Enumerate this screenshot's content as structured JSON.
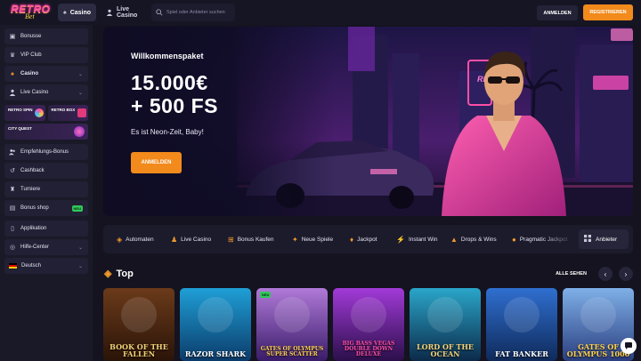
{
  "header": {
    "logo_text": "RETRO",
    "logo_sub": "Bet",
    "tabs": [
      {
        "label": "Casino",
        "icon": "spade-icon"
      },
      {
        "label": "Live Casino",
        "icon": "dealer-icon"
      }
    ],
    "search_placeholder": "Spiel oder Anbieter suchen",
    "login_label": "ANMELDEN",
    "register_label": "REGISTRIEREN"
  },
  "sidebar": {
    "items_top": [
      {
        "label": "Bonusse",
        "icon": "gift-icon"
      },
      {
        "label": "VIP Club",
        "icon": "crown-icon"
      },
      {
        "label": "Casino",
        "icon": "spade-icon"
      },
      {
        "label": "Live Casino",
        "icon": "dealer-icon"
      }
    ],
    "promos": [
      {
        "label": "RETRO SPIN"
      },
      {
        "label": "RETRO BOX"
      },
      {
        "label": "CITY QUEST"
      }
    ],
    "items_bottom": [
      {
        "label": "Empfehlungs-Bonus",
        "icon": "users-icon"
      },
      {
        "label": "Cashback",
        "icon": "cashback-icon"
      },
      {
        "label": "Turniere",
        "icon": "trophy-icon"
      },
      {
        "label": "Bonus shop",
        "icon": "shop-icon",
        "badge": "NEU"
      },
      {
        "label": "Applikation",
        "icon": "phone-icon"
      },
      {
        "label": "Hilfe-Center",
        "icon": "help-icon"
      },
      {
        "label": "Deutsch",
        "icon": "de-flag-icon"
      }
    ]
  },
  "hero": {
    "title": "Willkommenspaket",
    "line1": "15.000€",
    "line2": "+ 500 FS",
    "subtitle": "Es ist Neon-Zeit, Baby!",
    "button": "ANMELDEN",
    "sign_text": "RETRO"
  },
  "categories": [
    {
      "label": "Automaten",
      "icon": "slot-icon"
    },
    {
      "label": "Live Casino",
      "icon": "dealer-icon"
    },
    {
      "label": "Bonus Kaufen",
      "icon": "bonus-icon"
    },
    {
      "label": "Neue Spiele",
      "icon": "star-icon"
    },
    {
      "label": "Jackpot",
      "icon": "jackpot-icon"
    },
    {
      "label": "Instant Win",
      "icon": "bolt-icon"
    },
    {
      "label": "Drops & Wins",
      "icon": "drops-icon"
    },
    {
      "label": "Pragmatic Jackpot",
      "icon": "coin-icon"
    }
  ],
  "providers_label": "Anbieter",
  "top": {
    "title": "Top",
    "see_all": "ALLE SEHEN",
    "prev": "‹",
    "next": "›",
    "games": [
      {
        "title": "BOOK OF THE FALLEN",
        "colors": [
          "#6b3a1a",
          "#2a1408"
        ],
        "text_color": "#f3d27a"
      },
      {
        "title": "RAZOR SHARK",
        "colors": [
          "#1f9fd6",
          "#0b3c6b"
        ],
        "text_color": "#ffffff"
      },
      {
        "title": "GATES OF OLYMPUS SUPER SCATTER",
        "colors": [
          "#b07ad8",
          "#3a1c6a"
        ],
        "text_color": "#ffd34d",
        "badge": "NEU"
      },
      {
        "title": "BIG BASS VEGAS DOUBLE DOWN DELUXE",
        "colors": [
          "#a23ad8",
          "#2b0f4a"
        ],
        "text_color": "#ff4fa6"
      },
      {
        "title": "LORD OF THE OCEAN",
        "colors": [
          "#2aa6c9",
          "#0c2a4a"
        ],
        "text_color": "#f3d27a"
      },
      {
        "title": "FAT BANKER",
        "colors": [
          "#2f6fd0",
          "#0f2a5a"
        ],
        "text_color": "#ffffff"
      },
      {
        "title": "GATES OF OLYMPUS 1000",
        "colors": [
          "#7fb0e8",
          "#2b3e80"
        ],
        "text_color": "#ffd34d"
      }
    ]
  },
  "colors": {
    "accent": "#f28a1c",
    "bg": "#14131f",
    "sidebar": "#1a1928"
  }
}
